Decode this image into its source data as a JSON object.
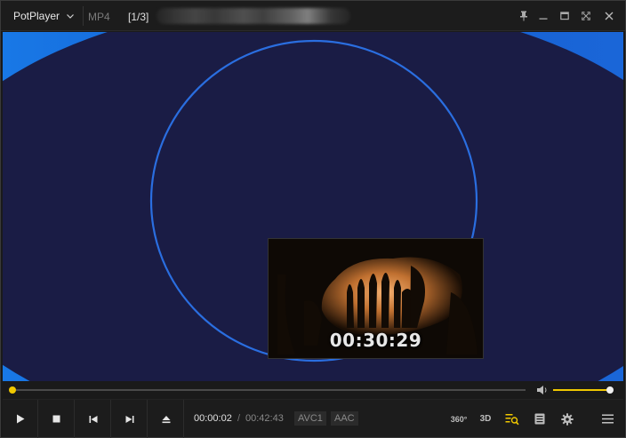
{
  "titlebar": {
    "app_name": "PotPlayer",
    "format": "MP4",
    "playlist_position": "[1/3]"
  },
  "preview": {
    "time": "00:30:29"
  },
  "playback": {
    "current_time": "00:00:02",
    "separator": "/",
    "total_time": "00:42:43",
    "progress_fraction": 0.0008,
    "volume_fraction": 1.0
  },
  "codecs": {
    "video": "AVC1",
    "audio": "AAC"
  },
  "toolbar": {
    "vr_label": "360°",
    "threed_label": "3D"
  },
  "colors": {
    "accent": "#f0c800",
    "video_bg_blue": "#1668d8",
    "video_dark_navy": "#1a1c45",
    "ring": "#2a6ee0"
  },
  "icons": {
    "app_menu": "chevron-down-icon",
    "pin": "pin-icon",
    "minimize": "minimize-icon",
    "maximize": "maximize-icon",
    "fullscreen": "fullscreen-icon",
    "close": "close-icon",
    "play": "play-icon",
    "stop": "stop-icon",
    "previous": "previous-icon",
    "next": "next-icon",
    "eject": "eject-icon",
    "volume": "volume-icon",
    "subtitle_search": "subtitle-search-icon",
    "playlist": "playlist-icon",
    "settings": "gear-icon",
    "menu": "hamburger-menu-icon"
  }
}
